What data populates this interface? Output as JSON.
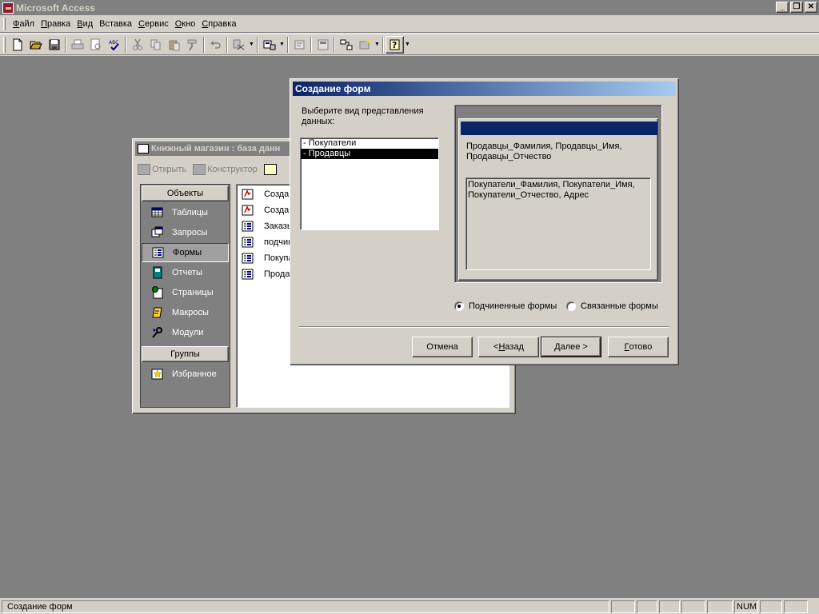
{
  "app": {
    "title": "Microsoft Access"
  },
  "menu": {
    "items": [
      {
        "acc": "Ф",
        "rest": "айл"
      },
      {
        "acc": "П",
        "rest": "равка"
      },
      {
        "acc": "В",
        "rest": "ид"
      },
      {
        "acc": "",
        "rest": "Вставка"
      },
      {
        "acc": "С",
        "rest": "ервис"
      },
      {
        "acc": "О",
        "rest": "кно"
      },
      {
        "acc": "С",
        "rest": "правка"
      }
    ]
  },
  "db_window": {
    "title": "Книжный магазин : база данн",
    "toolbar": {
      "open": "Открыть",
      "design": "Конструктор"
    },
    "objects_header": "Объекты",
    "groups_header": "Группы",
    "objects": [
      {
        "label": "Таблицы",
        "icon": "table-icon"
      },
      {
        "label": "Запросы",
        "icon": "query-icon"
      },
      {
        "label": "Формы",
        "icon": "form-icon"
      },
      {
        "label": "Отчеты",
        "icon": "report-icon"
      },
      {
        "label": "Страницы",
        "icon": "page-icon"
      },
      {
        "label": "Макросы",
        "icon": "macro-icon"
      },
      {
        "label": "Модули",
        "icon": "module-icon"
      }
    ],
    "groups": [
      {
        "label": "Избранное",
        "icon": "favorites-icon"
      }
    ],
    "forms_list": [
      {
        "label": "Создан",
        "icon": "wizard-icon"
      },
      {
        "label": "Создан",
        "icon": "wizard-icon"
      },
      {
        "label": "Заказы",
        "icon": "form-icon"
      },
      {
        "label": "подчин",
        "icon": "form-icon"
      },
      {
        "label": "Покупа",
        "icon": "form-icon"
      },
      {
        "label": "Прода",
        "icon": "form-icon"
      }
    ]
  },
  "wizard": {
    "title": "Создание форм",
    "prompt": "Выберите вид представления данных:",
    "list": [
      "- Покупатели",
      "- Продавцы"
    ],
    "selected_index": 1,
    "preview_main": "Продавцы_Фамилия, Продавцы_Имя, Продавцы_Отчество",
    "preview_sub": "Покупатели_Фамилия, Покупатели_Имя, Покупатели_Отчество, Адрес",
    "radio_subforms": "Подчиненные формы",
    "radio_linked": "Связанные формы",
    "subforms_selected": true,
    "btn_cancel": "Отмена",
    "btn_back": {
      "pre": "< ",
      "acc": "Н",
      "rest": "азад"
    },
    "btn_next": {
      "acc": "Д",
      "rest": "алее >"
    },
    "btn_finish": {
      "acc": "Г",
      "rest": "отово"
    }
  },
  "status": {
    "text": "Создание форм",
    "num": "NUM"
  }
}
